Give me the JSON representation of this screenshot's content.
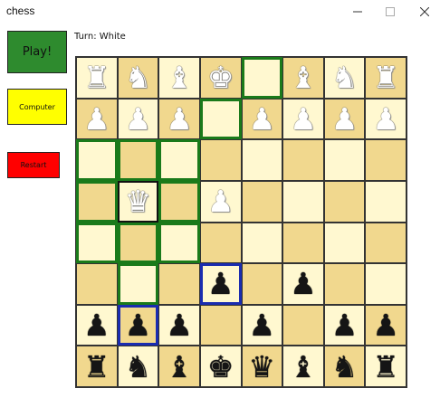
{
  "window": {
    "title": "chess",
    "controls": {
      "minimize": "minimize-icon",
      "maximize": "maximize-icon",
      "close": "close-icon"
    }
  },
  "buttons": {
    "play": {
      "label": "Play!",
      "color": "#2e8b2e"
    },
    "computer": {
      "label": "Computer",
      "color": "#ffff00"
    },
    "restart": {
      "label": "Restart",
      "color": "#ff0000"
    }
  },
  "status": {
    "turn_text": "Turn: White"
  },
  "board": {
    "light_color": "#fff8d0",
    "dark_color": "#f1d88e",
    "highlight_colors": {
      "green": "#1a7a1a",
      "blue": "#1a2cb0",
      "black": "#111111"
    },
    "pieces": [
      [
        "wR",
        "wN",
        "wB",
        "wK",
        "",
        "wB",
        "wN",
        "wR"
      ],
      [
        "wP",
        "wP",
        "wP",
        "",
        "wP",
        "wP",
        "wP",
        "wP"
      ],
      [
        "",
        "",
        "",
        "",
        "",
        "",
        "",
        ""
      ],
      [
        "",
        "wQ",
        "",
        "wP",
        "",
        "",
        "",
        ""
      ],
      [
        "",
        "",
        "",
        "",
        "",
        "",
        "",
        ""
      ],
      [
        "",
        "",
        "",
        "bP",
        "",
        "bP",
        "",
        ""
      ],
      [
        "bP",
        "bP",
        "bP",
        "",
        "bP",
        "",
        "bP",
        "bP"
      ],
      [
        "bR",
        "bN",
        "bB",
        "bK",
        "bQ",
        "bB",
        "bN",
        "bR"
      ]
    ],
    "highlights": [
      {
        "row": 0,
        "col": 4,
        "type": "green"
      },
      {
        "row": 1,
        "col": 3,
        "type": "green"
      },
      {
        "row": 2,
        "col": 0,
        "type": "green"
      },
      {
        "row": 2,
        "col": 1,
        "type": "green"
      },
      {
        "row": 2,
        "col": 2,
        "type": "green"
      },
      {
        "row": 3,
        "col": 0,
        "type": "green"
      },
      {
        "row": 3,
        "col": 1,
        "type": "black"
      },
      {
        "row": 3,
        "col": 2,
        "type": "green"
      },
      {
        "row": 4,
        "col": 0,
        "type": "green"
      },
      {
        "row": 4,
        "col": 1,
        "type": "green"
      },
      {
        "row": 4,
        "col": 2,
        "type": "green"
      },
      {
        "row": 5,
        "col": 1,
        "type": "green"
      },
      {
        "row": 5,
        "col": 3,
        "type": "blue"
      },
      {
        "row": 6,
        "col": 1,
        "type": "blue"
      }
    ]
  }
}
